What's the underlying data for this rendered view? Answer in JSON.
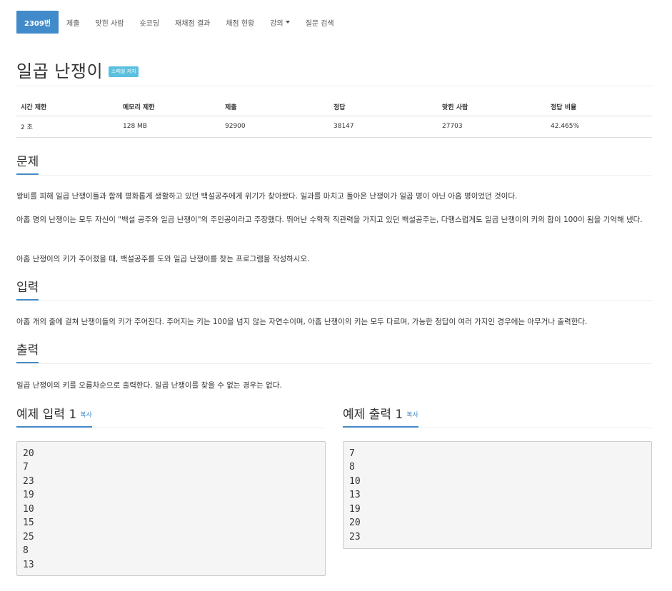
{
  "nav": {
    "items": [
      {
        "label": "2309번",
        "active": true
      },
      {
        "label": "제출"
      },
      {
        "label": "맞힌 사람"
      },
      {
        "label": "숏코딩"
      },
      {
        "label": "재채점 결과"
      },
      {
        "label": "채점 현황"
      },
      {
        "label": "강의",
        "dropdown": true
      },
      {
        "label": "질문 검색"
      }
    ]
  },
  "problem": {
    "title": "일곱 난쟁이",
    "badge": "스페셜 저지"
  },
  "info_table": {
    "headers": [
      "시간 제한",
      "메모리 제한",
      "제출",
      "정답",
      "맞힌 사람",
      "정답 비율"
    ],
    "row": [
      "2 초",
      "128 MB",
      "92900",
      "38147",
      "27703",
      "42.465%"
    ]
  },
  "sections": {
    "problem_heading": "문제",
    "problem_paragraphs": [
      "왕비를 피해 일곱 난쟁이들과 함께 평화롭게 생활하고 있던 백설공주에게 위기가 찾아왔다. 일과를 마치고 돌아온 난쟁이가 일곱 명이 아닌 아홉 명이었던 것이다.",
      "아홉 명의 난쟁이는 모두 자신이 \"백설 공주와 일곱 난쟁이\"의 주인공이라고 주장했다. 뛰어난 수학적 직관력을 가지고 있던 백설공주는, 다행스럽게도 일곱 난쟁이의 키의 합이 100이 됨을 기억해 냈다.",
      "아홉 난쟁이의 키가 주어졌을 때, 백설공주를 도와 일곱 난쟁이를 찾는 프로그램을 작성하시오."
    ],
    "input_heading": "입력",
    "input_text": "아홉 개의 줄에 걸쳐 난쟁이들의 키가 주어진다. 주어지는 키는 100을 넘지 않는 자연수이며, 아홉 난쟁이의 키는 모두 다르며, 가능한 정답이 여러 가지인 경우에는 아무거나 출력한다.",
    "output_heading": "출력",
    "output_text": "일곱 난쟁이의 키를 오름차순으로 출력한다. 일곱 난쟁이를 찾을 수 없는 경우는 없다."
  },
  "samples": {
    "input_heading": "예제 입력 1",
    "input_copy": "복사",
    "input_data": "20\n7\n23\n19\n10\n15\n25\n8\n13",
    "output_heading": "예제 출력 1",
    "output_copy": "복사",
    "output_data": "7\n8\n10\n13\n19\n20\n23"
  },
  "colors": {
    "primary": "#428bca",
    "badge": "#5bc0de",
    "pre_background": "#f5f5f5"
  }
}
